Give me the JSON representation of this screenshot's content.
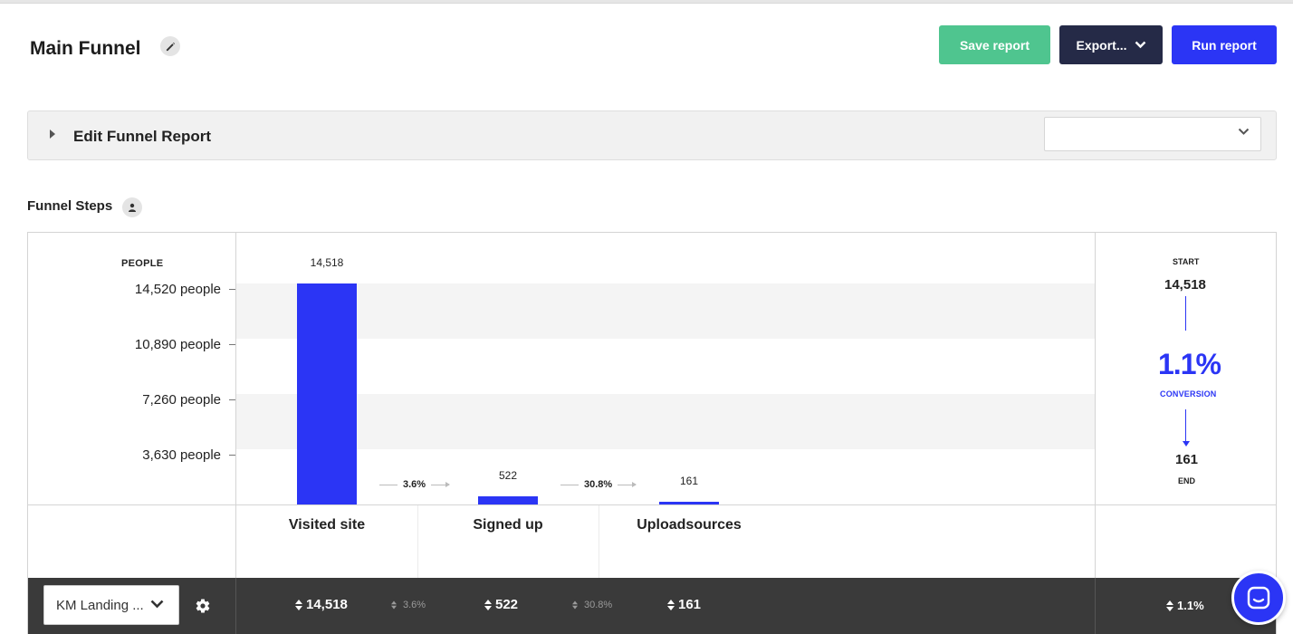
{
  "header": {
    "title": "Main Funnel",
    "save_label": "Save report",
    "export_label": "Export...",
    "run_label": "Run report"
  },
  "edit_panel": {
    "label": "Edit Funnel Report",
    "select_value": ""
  },
  "funnel": {
    "section_title": "Funnel Steps",
    "y_axis_label": "PEOPLE",
    "y_ticks": [
      "14,520 people",
      "10,890 people",
      "7,260 people",
      "3,630 people"
    ],
    "steps": [
      {
        "name": "Visited site",
        "value_label": "14,518"
      },
      {
        "name": "Signed up",
        "value_label": "522"
      },
      {
        "name": "Uploadsources",
        "value_label": "161"
      }
    ],
    "conversions": [
      "3.6%",
      "30.8%"
    ]
  },
  "chart_data": {
    "type": "bar",
    "categories": [
      "Visited site",
      "Signed up",
      "Uploadsources"
    ],
    "values": [
      14518,
      522,
      161
    ],
    "title": "",
    "xlabel": "",
    "ylabel": "PEOPLE",
    "ylim": [
      0,
      14520
    ],
    "yticks": [
      3630,
      7260,
      10890,
      14520
    ],
    "step_conversions": [
      "3.6%",
      "30.8%"
    ],
    "grid": false,
    "color": "#2b35f5"
  },
  "summary": {
    "start_label": "START",
    "start_value": "14,518",
    "conversion_pct": "1.1%",
    "conversion_label": "CONVERSION",
    "end_value": "161",
    "end_label": "END"
  },
  "footer": {
    "segment_value": "KM Landing ...",
    "stats": [
      "14,518",
      "522",
      "161"
    ],
    "pcts": [
      "3.6%",
      "30.8%"
    ],
    "total_pct": "1.1%"
  },
  "colors": {
    "primary": "#2b35f5",
    "save_green": "#4fc58f",
    "export_navy": "#252a47",
    "footer_dark": "#3a3a3a"
  }
}
